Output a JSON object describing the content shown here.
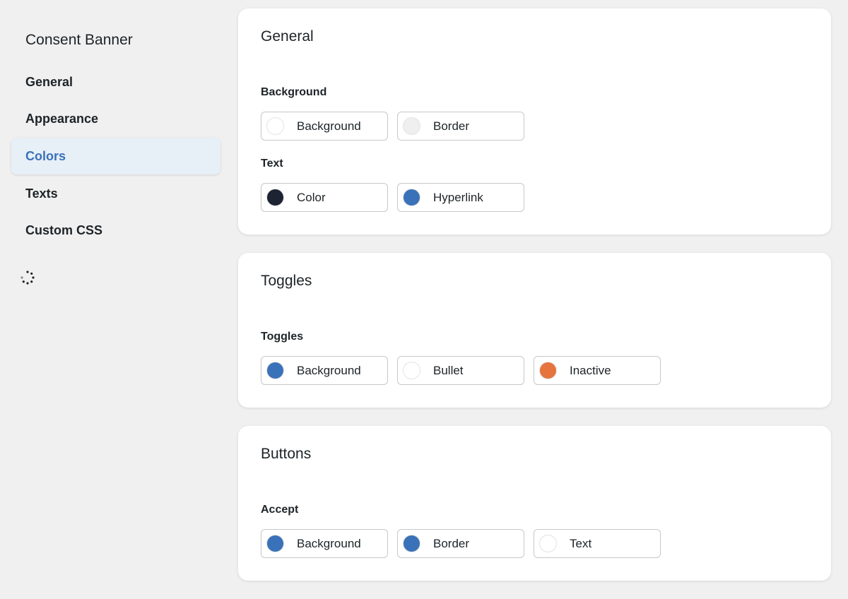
{
  "sidebar": {
    "title": "Consent Banner",
    "items": [
      {
        "label": "General"
      },
      {
        "label": "Appearance"
      },
      {
        "label": "Colors"
      },
      {
        "label": "Texts"
      },
      {
        "label": "Custom CSS"
      }
    ],
    "active_index": 2
  },
  "colors": {
    "white": "#ffffff",
    "light_gray": "#efefef",
    "dark_navy": "#1d2333",
    "blue": "#3a72b9",
    "orange": "#e5743e"
  },
  "cards": [
    {
      "title": "General",
      "groups": [
        {
          "label": "Background",
          "swatches": [
            {
              "label": "Background",
              "color": "#ffffff"
            },
            {
              "label": "Border",
              "color": "#efefef"
            }
          ]
        },
        {
          "label": "Text",
          "swatches": [
            {
              "label": "Color",
              "color": "#1d2333"
            },
            {
              "label": "Hyperlink",
              "color": "#3a72b9"
            }
          ]
        }
      ]
    },
    {
      "title": "Toggles",
      "groups": [
        {
          "label": "Toggles",
          "swatches": [
            {
              "label": "Background",
              "color": "#3a72b9"
            },
            {
              "label": "Bullet",
              "color": "#ffffff"
            },
            {
              "label": "Inactive",
              "color": "#e5743e"
            }
          ]
        }
      ]
    },
    {
      "title": "Buttons",
      "groups": [
        {
          "label": "Accept",
          "swatches": [
            {
              "label": "Background",
              "color": "#3a72b9"
            },
            {
              "label": "Border",
              "color": "#3a72b9"
            },
            {
              "label": "Text",
              "color": "#ffffff"
            }
          ]
        }
      ]
    }
  ]
}
